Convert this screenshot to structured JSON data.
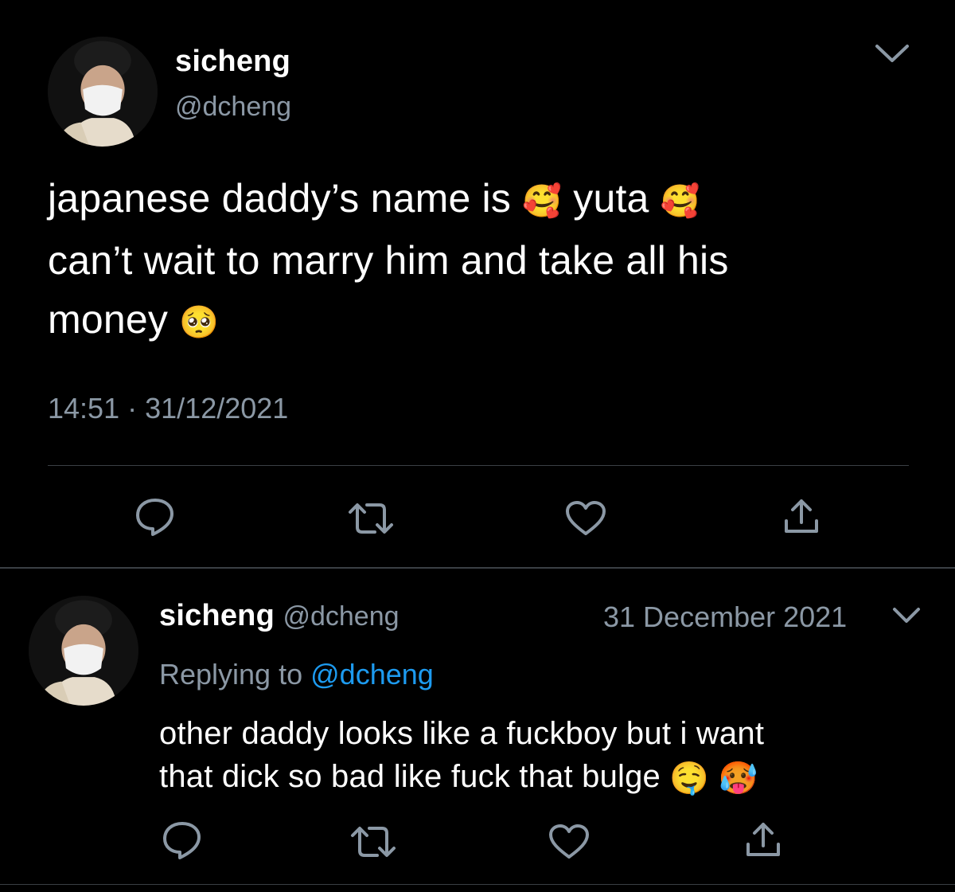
{
  "tweet": {
    "author_name": "sicheng",
    "author_handle": "@dcheng",
    "text_line1": "japanese daddy’s name is",
    "text_line1_b": "yuta",
    "text_line2": "can’t wait to marry him and take all his",
    "text_line3": "money",
    "emoji_hearts": "🥰",
    "emoji_pleading": "🥺",
    "time": "14:51",
    "separator": "·",
    "date": "31/12/2021"
  },
  "reply": {
    "author_name": "sicheng",
    "author_handle": "@dcheng",
    "date": "31 December 2021",
    "replying_label": "Replying to",
    "replying_handle": "@dcheng",
    "text_line1": "other daddy looks like a fuckboy but i want",
    "text_line2": "that dick so bad like fuck that bulge",
    "emoji_drool": "🤤",
    "emoji_hot": "🥵"
  },
  "icons": {
    "reply": "reply-icon",
    "retweet": "retweet-icon",
    "like": "heart-icon",
    "share": "share-icon",
    "more": "chevron-down-icon"
  },
  "colors": {
    "background": "#000000",
    "text": "#ffffff",
    "secondary": "#8b98a5",
    "link": "#1d9bf0",
    "divider": "#3a3f44"
  }
}
